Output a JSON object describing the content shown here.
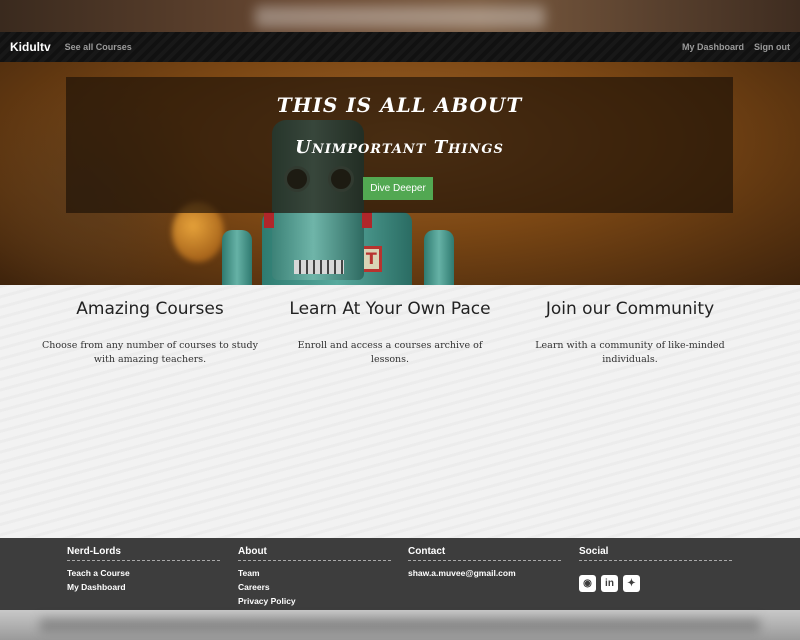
{
  "navbar": {
    "brand": "Kidultv",
    "see_all": "See all Courses",
    "dashboard": "My Dashboard",
    "sign_out": "Sign out"
  },
  "hero": {
    "title_line1": "This is all about",
    "title_line2": "Unimportant Things",
    "cta": "Dive Deeper",
    "robot_plate": "ROBOT"
  },
  "features": [
    {
      "title": "Amazing Courses",
      "text": "Choose from any number of courses to study with amazing teachers."
    },
    {
      "title": "Learn At Your Own Pace",
      "text": "Enroll and access a courses archive of lessons."
    },
    {
      "title": "Join our Community",
      "text": "Learn with a community of like-minded individuals."
    }
  ],
  "footer": {
    "col1": {
      "heading": "Nerd-Lords",
      "links": [
        "Teach a Course",
        "My Dashboard"
      ]
    },
    "col2": {
      "heading": "About",
      "links": [
        "Team",
        "Careers",
        "Privacy Policy"
      ]
    },
    "col3": {
      "heading": "Contact",
      "links": [
        "shaw.a.muvee@gmail.com"
      ]
    },
    "col4": {
      "heading": "Social",
      "icons": [
        "github-icon",
        "linkedin-icon",
        "twitter-icon"
      ]
    }
  }
}
